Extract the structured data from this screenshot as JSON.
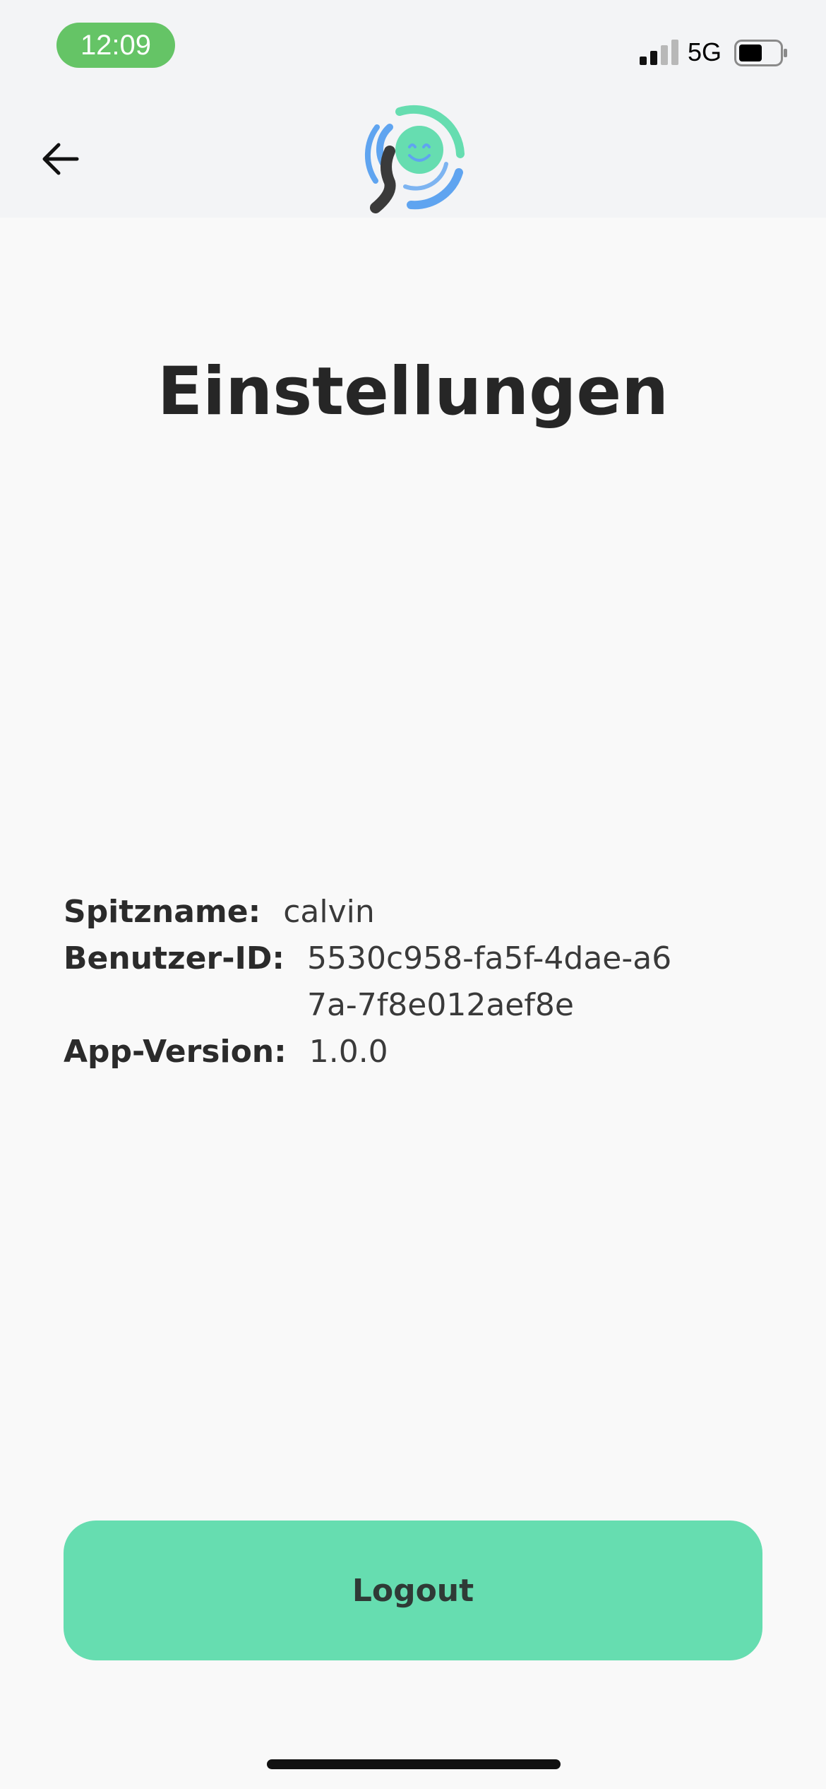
{
  "status_bar": {
    "time": "12:09",
    "network": "5G",
    "time_pill_color": "#65c466"
  },
  "nav": {
    "back_icon": "arrow-left-icon",
    "logo_icon": "app-logo-smiley-icon"
  },
  "page": {
    "title": "Einstellungen"
  },
  "info": {
    "nickname_label": "Spitzname:",
    "nickname_value": "calvin",
    "user_id_label": "Benutzer-ID:",
    "user_id_value": "5530c958-fa5f-4dae-a67a-7f8e012aef8e",
    "app_version_label": "App-Version:",
    "app_version_value": "1.0.0"
  },
  "actions": {
    "logout_label": "Logout",
    "accent_color": "#66ddb0"
  }
}
